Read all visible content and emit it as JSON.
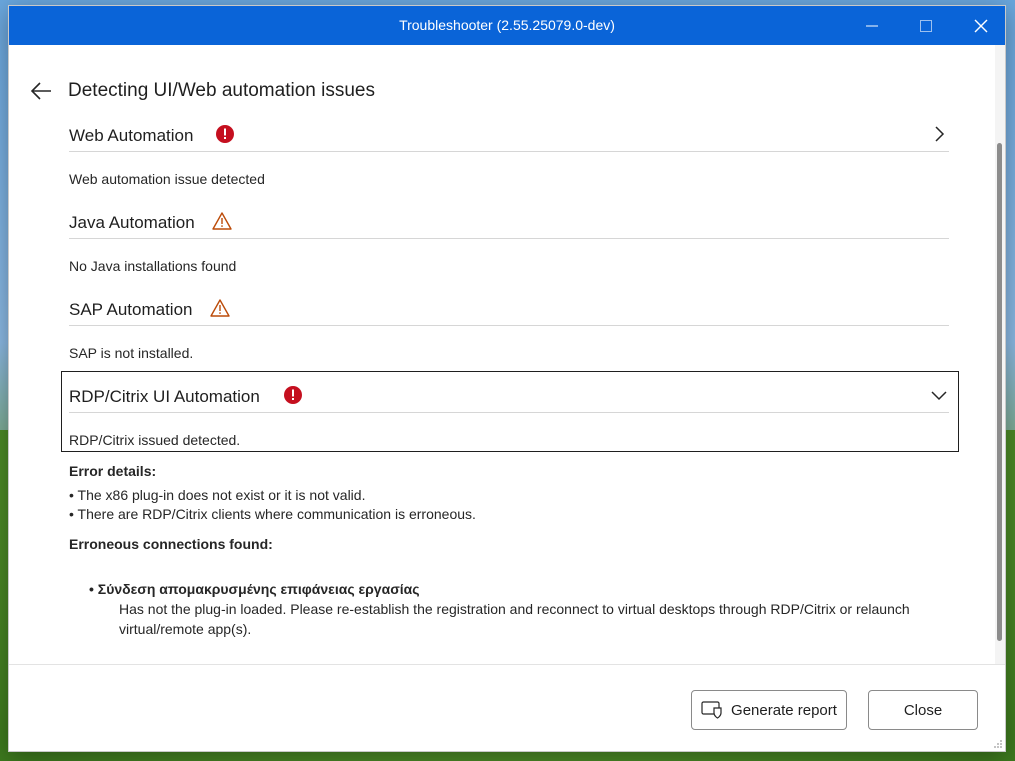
{
  "window": {
    "title": "Troubleshooter (2.55.25079.0-dev)",
    "controls": [
      "minimize-icon",
      "maximize-icon",
      "close-icon"
    ]
  },
  "page": {
    "title": "Detecting UI/Web automation issues"
  },
  "sections": [
    {
      "name": "Web Automation",
      "status": "error",
      "status_icon": "error-circle-icon",
      "description": "Web automation issue detected",
      "chevron": "chevron-right-icon"
    },
    {
      "name": "Java Automation",
      "status": "warning",
      "status_icon": "warning-triangle-icon",
      "description": "No Java installations found"
    },
    {
      "name": "SAP Automation",
      "status": "warning",
      "status_icon": "warning-triangle-icon",
      "description": "SAP is not installed."
    },
    {
      "name": "RDP/Citrix UI Automation",
      "status": "error",
      "status_icon": "error-circle-icon",
      "description": "RDP/Citrix issued detected.",
      "chevron": "chevron-down-icon",
      "expanded": true
    }
  ],
  "details": {
    "error_details_title": "Error details:",
    "errors": [
      "• The x86 plug-in does not exist or it is not valid.",
      "• There are RDP/Citrix clients where communication is erroneous."
    ],
    "connections_title": "Erroneous connections found:",
    "connections": [
      {
        "name": "• Σύνδεση απομακρυσμένης επιφάνειας εργασίας",
        "description": "Has not the plug-in loaded. Please re-establish the registration and reconnect to virtual desktops through RDP/Citrix or relaunch virtual/remote app(s)."
      }
    ]
  },
  "footer": {
    "generate_report_label": "Generate report",
    "close_label": "Close"
  },
  "colors": {
    "titlebar": "#0a64d8",
    "error": "#c50f1f",
    "warning": "#bc4b09"
  }
}
